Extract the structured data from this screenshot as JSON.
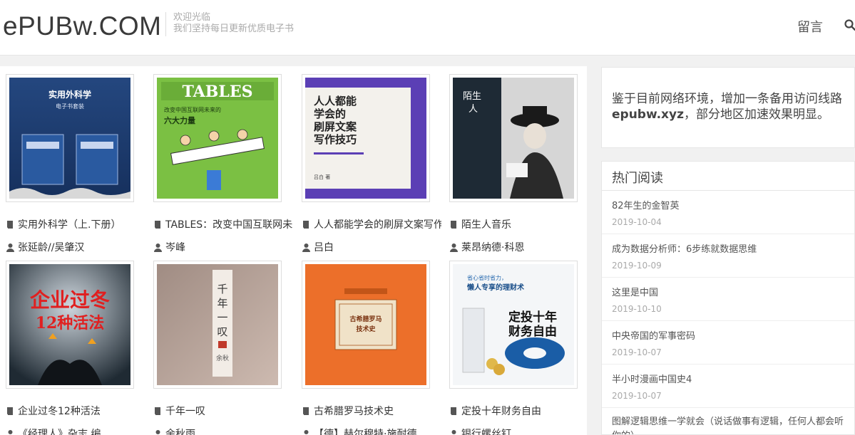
{
  "site": {
    "logo": "ePUBw.COM",
    "tagline_line1": "欢迎光临",
    "tagline_line2": "我们坚持每日更新优质电子书",
    "nav_message": "留言"
  },
  "books": [
    {
      "title": "实用外科学（上.下册）",
      "author": "张延龄//吴肇汉",
      "cover_text": "实用外科学",
      "cover_sub": "电子书套装"
    },
    {
      "title": "TABLES：改变中国互联网未来的六大力量",
      "author": "岑峰",
      "cover_text": "TABLES",
      "cover_sub": "改变中国互联网未来的六大力量"
    },
    {
      "title": "人人都能学会的刷屏文案写作技巧",
      "author": "吕白",
      "cover_text": "人人都能学会的刷屏文案写作技巧",
      "cover_sub": ""
    },
    {
      "title": "陌生人音乐",
      "author": "莱昂纳德·科恩",
      "cover_text": "陌生人音乐",
      "cover_sub": ""
    },
    {
      "title": "企业过冬12种活法",
      "author": "《经理人》杂志 编",
      "cover_text": "企业过冬12种活法",
      "cover_sub": ""
    },
    {
      "title": "千年一叹",
      "author": "余秋雨",
      "cover_text": "千年一叹",
      "cover_sub": "余秋雨"
    },
    {
      "title": "古希腊罗马技术史",
      "author": "【德】赫尔穆特·施耐德",
      "cover_text": "古希腊罗马技术史",
      "cover_sub": ""
    },
    {
      "title": "定投十年财务自由",
      "author": "银行螺丝钉",
      "cover_text": "定投十年财务自由",
      "cover_sub": "懒人专享的理财术"
    }
  ],
  "notice": {
    "text_before": "鉴于目前网络环境，增加一条备用访问线路 ",
    "domain": "epubw.xyz",
    "text_after": "，部分地区加速效果明显。"
  },
  "hot": {
    "title": "热门阅读",
    "items": [
      {
        "title": "82年生的金智英",
        "date": "2019-10-04"
      },
      {
        "title": "成为数据分析师：6步练就数据思维",
        "date": "2019-10-09"
      },
      {
        "title": "这里是中国",
        "date": "2019-10-10"
      },
      {
        "title": "中央帝国的军事密码",
        "date": "2019-10-07"
      },
      {
        "title": "半小时漫画中国史4",
        "date": "2019-10-07"
      },
      {
        "title": "图解逻辑思维一学就会（说话做事有逻辑，任何人都会听你的）",
        "date": ""
      }
    ]
  }
}
